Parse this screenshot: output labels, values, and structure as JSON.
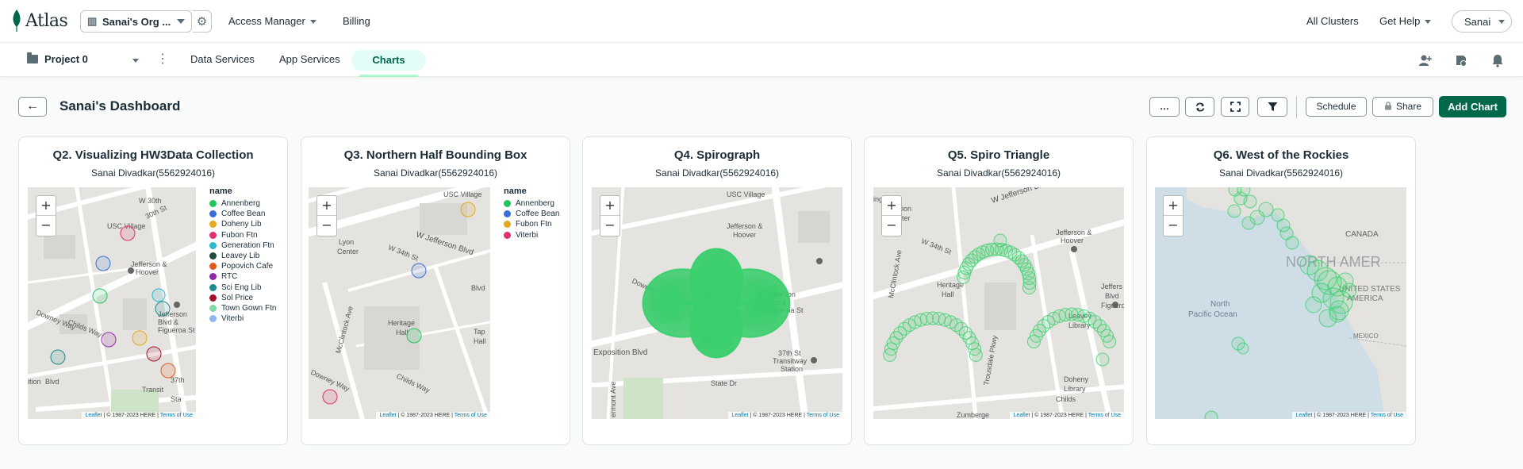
{
  "app": {
    "logo_text": "Atlas",
    "org_name": "Sanai's Org ...",
    "nav": [
      "Access Manager",
      "Billing"
    ],
    "right_nav": [
      "All Clusters",
      "Get Help"
    ],
    "user": "Sanai"
  },
  "project": {
    "name": "Project 0",
    "tabs": [
      "Data Services",
      "App Services",
      "Charts"
    ],
    "active_tab": "Charts"
  },
  "dashboard": {
    "title": "Sanai's Dashboard",
    "toolbar": {
      "more": "…",
      "schedule": "Schedule",
      "share": "Share",
      "add_chart": "Add Chart"
    }
  },
  "colors": {
    "accent": "#00684a",
    "spiro_green": "#3ccf6f",
    "tab_bg": "#e3fcf7"
  },
  "charts": [
    {
      "title": "Q2. Visualizing HW3Data Collection",
      "author": "Sanai Divadkar(5562924016)",
      "legend_title": "name",
      "legend": [
        {
          "label": "Annenberg",
          "color": "#22c55e"
        },
        {
          "label": "Coffee Bean",
          "color": "#3b6fd6"
        },
        {
          "label": "Doheny Lib",
          "color": "#e5a91b"
        },
        {
          "label": "Fubon Ftn",
          "color": "#e0306f"
        },
        {
          "label": "Generation Ftn",
          "color": "#2cb8cf"
        },
        {
          "label": "Leavey Lib",
          "color": "#1f4d3a"
        },
        {
          "label": "Popovich Cafe",
          "color": "#e2591e"
        },
        {
          "label": "RTC",
          "color": "#8e2aa8"
        },
        {
          "label": "Sci Eng Lib",
          "color": "#1f8a8a"
        },
        {
          "label": "Sol Price",
          "color": "#a3122a"
        },
        {
          "label": "Town Gown Ftn",
          "color": "#7ed8a4"
        },
        {
          "label": "Viterbi",
          "color": "#92b6ee"
        }
      ]
    },
    {
      "title": "Q3. Northern Half Bounding Box",
      "author": "Sanai Divadkar(5562924016)",
      "legend_title": "name",
      "legend": [
        {
          "label": "Annenberg",
          "color": "#22c55e"
        },
        {
          "label": "Coffee Bean",
          "color": "#3b6fd6"
        },
        {
          "label": "Fubon Ftn",
          "color": "#e5a91b"
        },
        {
          "label": "Viterbi",
          "color": "#e0306f"
        }
      ]
    },
    {
      "title": "Q4. Spirograph",
      "author": "Sanai Divadkar(5562924016)"
    },
    {
      "title": "Q5. Spiro Triangle",
      "author": "Sanai Divadkar(5562924016)"
    },
    {
      "title": "Q6. West of the Rockies",
      "author": "Sanai Divadkar(5562924016)"
    }
  ],
  "map_labels": {
    "q2": [
      "W 30th",
      "USC Village",
      "Jefferson &",
      "Hoover",
      "Jefferson",
      "Blvd &",
      "Figueroa St",
      "Childs Way",
      "Downey Way",
      "37th",
      "Transit",
      "Sta",
      "ition",
      "Blvd",
      "30th St"
    ],
    "q3": [
      "USC Village",
      "W Jefferson Blvd",
      "Lyon",
      "Center",
      "W 34th St",
      "Heritage",
      "Hall",
      "McClintock Ave",
      "Childs Way",
      "Downey Way",
      "Tap",
      "Hall",
      "Blvd"
    ],
    "q4": [
      "USC Village",
      "Jefferson &",
      "Hoover",
      "Jefferson",
      "Blvd &",
      "Figueroa St",
      "Downey",
      "Exposition Blvd",
      "37th St",
      "Transitway",
      "Station",
      "State Dr",
      "ermont Ave"
    ],
    "q5": [
      "ington",
      "ion",
      "ter",
      "W Jefferson Blvd",
      "Jefferson &",
      "Hoover",
      "W 34th St",
      "Heritage",
      "Hall",
      "Jeffers",
      "Blvd",
      "Figueroa",
      "Leavey",
      "Library",
      "Doheny",
      "Library",
      "Childs",
      "Zumberge",
      "McClintock Ave",
      "Trousdale Pkwy"
    ],
    "q6": [
      "CANADA",
      "NORTH AMER",
      "North",
      "Pacific Ocean",
      "UNITED STATES",
      "AMERICA",
      "MEXICO"
    ]
  },
  "map_ui": {
    "zoom_in": "+",
    "zoom_out": "−",
    "leaflet": "Leaflet",
    "copyright": "| © 1987-2023 HERE |",
    "terms": "Terms of Use"
  }
}
